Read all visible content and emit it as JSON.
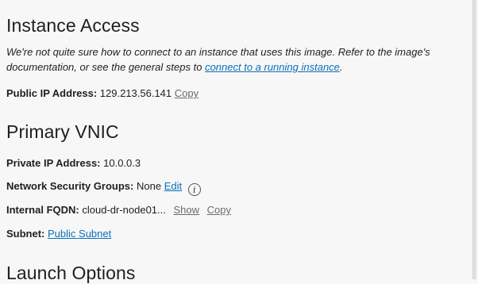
{
  "instance_access": {
    "title": "Instance Access",
    "intro_text": "We're not quite sure how to connect to an instance that uses this image. Refer to the image's documentation, or see the general steps to",
    "intro_link": "connect to a running instance",
    "intro_end": ".",
    "public_ip_label": "Public IP Address:",
    "public_ip_value": "129.213.56.141",
    "copy_label": "Copy"
  },
  "primary_vnic": {
    "title": "Primary VNIC",
    "private_ip_label": "Private IP Address:",
    "private_ip_value": "10.0.0.3",
    "nsg_label": "Network Security Groups:",
    "nsg_value": "None",
    "edit_label": "Edit",
    "info_icon": "i",
    "fqdn_label": "Internal FQDN:",
    "fqdn_value": "cloud-dr-node01...",
    "show_label": "Show",
    "copy_label": "Copy",
    "subnet_label": "Subnet:",
    "subnet_value": "Public Subnet"
  },
  "launch_options": {
    "title": "Launch Options"
  }
}
